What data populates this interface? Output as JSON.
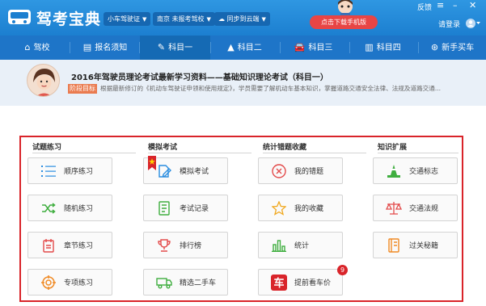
{
  "app": {
    "title": "驾考宝典"
  },
  "header": {
    "license_type": "小车驾驶证",
    "school": "南京 未报考驾校",
    "sync": "同步到云端",
    "promo": "点击下载手机版",
    "feedback": "反馈",
    "login": "请登录"
  },
  "nav": {
    "items": [
      {
        "label": "驾校",
        "icon": "home-icon"
      },
      {
        "label": "报名须知",
        "icon": "document-icon"
      },
      {
        "label": "科目一",
        "icon": "edit-icon"
      },
      {
        "label": "科目二",
        "icon": "road-cone-icon"
      },
      {
        "label": "科目三",
        "icon": "car-icon"
      },
      {
        "label": "科目四",
        "icon": "book-icon"
      },
      {
        "label": "新手买车",
        "icon": "steering-wheel-icon"
      }
    ],
    "active": "科目一"
  },
  "banner": {
    "title": "2016年驾驶员理论考试最新学习资料——基础知识理论考试（科目一）",
    "tag": "阶段目标",
    "desc": "根据最新修订的《机动车驾驶证申领和使用规定》，学员需要了解机动车基本知识，掌握道路交通安全法律、法规及道路交通..."
  },
  "columns": [
    {
      "title": "试题练习",
      "buttons": [
        {
          "label": "顺序练习",
          "icon": "list-icon"
        },
        {
          "label": "随机练习",
          "icon": "shuffle-icon"
        },
        {
          "label": "章节练习",
          "icon": "chapter-icon"
        },
        {
          "label": "专项练习",
          "icon": "target-icon"
        }
      ]
    },
    {
      "title": "模拟考试",
      "buttons": [
        {
          "label": "模拟考试",
          "icon": "exam-pencil-icon"
        },
        {
          "label": "考试记录",
          "icon": "record-icon"
        },
        {
          "label": "排行榜",
          "icon": "trophy-icon"
        },
        {
          "label": "精选二手车",
          "icon": "truck-icon"
        }
      ]
    },
    {
      "title": "统计错题收藏",
      "buttons": [
        {
          "label": "我的错题",
          "icon": "x-circle-icon"
        },
        {
          "label": "我的收藏",
          "icon": "star-icon"
        },
        {
          "label": "统计",
          "icon": "bar-chart-icon"
        },
        {
          "label": "提前看车价",
          "icon": "car-price-icon"
        }
      ]
    },
    {
      "title": "知识扩展",
      "buttons": [
        {
          "label": "交通标志",
          "icon": "traffic-sign-icon"
        },
        {
          "label": "交通法规",
          "icon": "scales-icon"
        },
        {
          "label": "过关秘籍",
          "icon": "book-tips-icon"
        }
      ]
    }
  ],
  "car_price_badge": "9",
  "colors": {
    "blue": "#1e75c8",
    "accent_red": "#d9242a",
    "icon_blue": "#2a8de0",
    "icon_green": "#3fae3f",
    "icon_red": "#e34a4a",
    "icon_orange": "#f08a24"
  }
}
